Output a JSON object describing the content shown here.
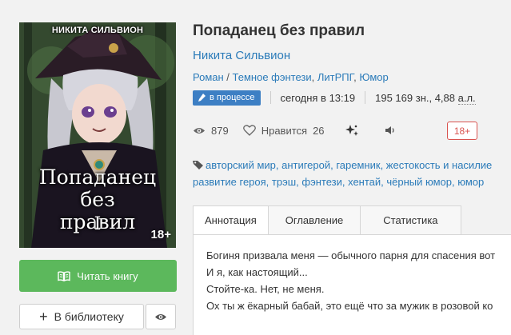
{
  "cover": {
    "author_text": "НИКИТА СИЛЬВИОН",
    "title_line1": "Попаданец без",
    "title_line2": "правил",
    "volume": "I",
    "age": "18+"
  },
  "book": {
    "title": "Попаданец без правил",
    "author": "Никита Сильвион",
    "genres": [
      "Роман",
      "Темное фэнтези",
      "ЛитРПГ",
      "Юмор"
    ],
    "genre_separator": " / ",
    "status_badge": "в процессе",
    "updated": "сегодня в 13:19",
    "size": "195 169 зн., 4,88 ",
    "size_unit": "а.л."
  },
  "stats": {
    "views": "879",
    "likes_label": "Нравится",
    "likes": "26",
    "age_rating": "18+"
  },
  "tags": {
    "line1": "авторский мир, антигерой, гаремник, жестокость и насилие",
    "line2": "развитие героя, трэш, фэнтези, хентай, чёрный юмор, юмор"
  },
  "buttons": {
    "read": "Читать книгу",
    "library": "В библиотеку"
  },
  "tabs": [
    {
      "label": "Аннотация",
      "active": true
    },
    {
      "label": "Оглавление",
      "active": false
    },
    {
      "label": "Статистика",
      "active": false
    }
  ],
  "annotation": [
    "Богиня призвала меня — обычного парня для спасения вот",
    "И я, как настоящий...",
    "Стойте-ка. Нет, не меня.",
    "Ох ты ж ёкарный бабай, это ещё что за мужик в розовой ко"
  ],
  "colors": {
    "accent": "#2b7bb9",
    "read_button": "#5cb85c",
    "status_badge": "#3d7fc4",
    "age_badge": "#d9534f"
  }
}
